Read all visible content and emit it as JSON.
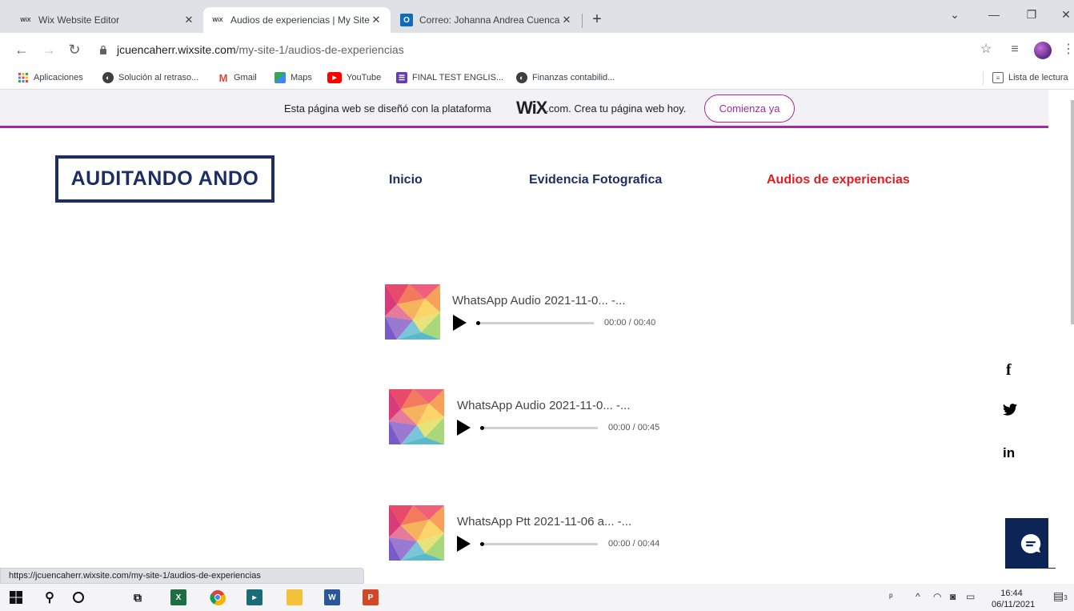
{
  "browser": {
    "tabs": [
      {
        "title": "Wix Website Editor",
        "favicon": "WiX",
        "active": false
      },
      {
        "title": "Audios de experiencias | My Site",
        "favicon": "WiX",
        "active": true
      },
      {
        "title": "Correo: Johanna Andrea Cuenca",
        "favicon": "O",
        "active": false
      }
    ],
    "new_tab": "+",
    "url_host": "jcuencaherr.wixsite.com",
    "url_path": "/my-site-1/audios-de-experiencias",
    "bookmarks": [
      {
        "label": "Aplicaciones",
        "icon": "apps-grid-icon"
      },
      {
        "label": "Solución al retraso...",
        "icon": "globe-icon"
      },
      {
        "label": "Gmail",
        "icon": "gmail-icon"
      },
      {
        "label": "Maps",
        "icon": "maps-icon"
      },
      {
        "label": "YouTube",
        "icon": "youtube-icon"
      },
      {
        "label": "FINAL TEST ENGLIS...",
        "icon": "forms-icon"
      },
      {
        "label": "Finanzas contabilid...",
        "icon": "globe-icon"
      }
    ],
    "reading_list": "Lista de lectura",
    "status_url": "https://jcuencaherr.wixsite.com/my-site-1/audios-de-experiencias"
  },
  "banner": {
    "text": "Esta página web se diseñó con la plataforma",
    "logo": "WiX",
    "suffix": ".com. Crea tu página web hoy.",
    "button": "Comienza ya",
    "accent": "#a429a2"
  },
  "site": {
    "logo": "AUDITANDO ANDO",
    "menu": [
      {
        "label": "Inicio",
        "current": false
      },
      {
        "label": "Evidencia Fotografica",
        "current": false
      },
      {
        "label": "Audios de experiencias",
        "current": true
      }
    ],
    "players": [
      {
        "title": "WhatsApp Audio 2021-11-0...  -...",
        "time": "00:00 / 00:40"
      },
      {
        "title": "WhatsApp Audio 2021-11-0...  -...",
        "time": "00:00 / 00:45"
      },
      {
        "title": "WhatsApp Ptt 2021-11-06 a...  -...",
        "time": "00:00 / 00:44"
      }
    ],
    "social": [
      "facebook-icon",
      "twitter-icon",
      "linkedin-icon"
    ],
    "colors": {
      "navy": "#1d2e63",
      "active": "#e21c21",
      "chat": "#0d2556"
    }
  },
  "taskbar": {
    "time": "16:44",
    "date": "06/11/2021",
    "notifications": "3"
  }
}
